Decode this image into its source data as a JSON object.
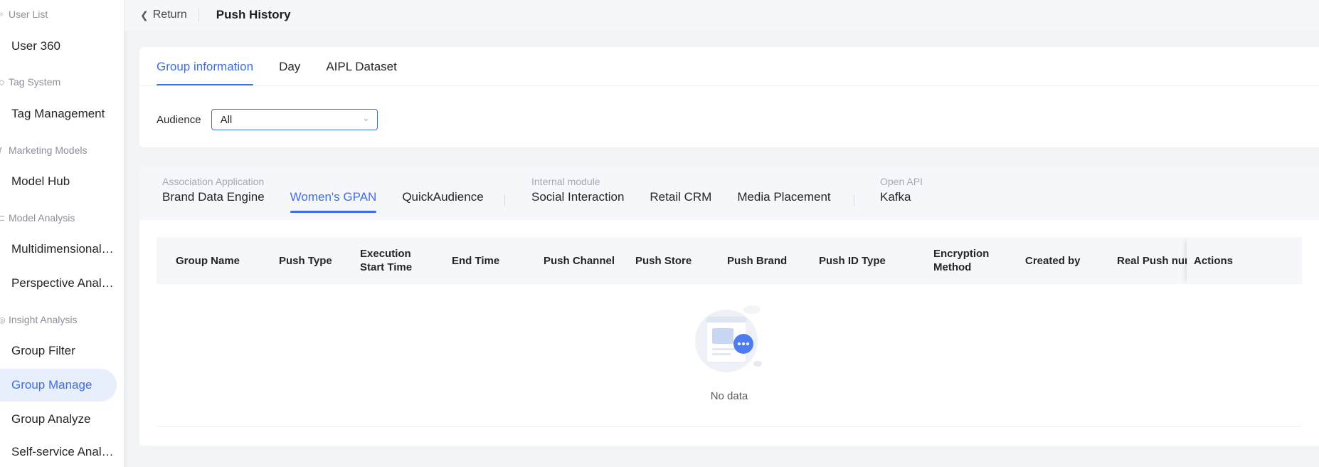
{
  "sidebar": {
    "groups": [
      {
        "label": "User List",
        "icon": "users-icon"
      },
      {
        "label": "Tag System",
        "icon": "tag-icon"
      },
      {
        "label": "Marketing Models",
        "icon": "model-icon"
      },
      {
        "label": "Model Analysis",
        "icon": "analysis-icon"
      },
      {
        "label": "Insight Analysis",
        "icon": "insight-icon"
      }
    ],
    "items": [
      {
        "label": "User 360"
      },
      {
        "label": "Tag Management"
      },
      {
        "label": "Model Hub"
      },
      {
        "label": "Multidimensional Analysis"
      },
      {
        "label": "Perspective Analysis"
      },
      {
        "label": "Group Filter"
      },
      {
        "label": "Group Manage",
        "active": true
      },
      {
        "label": "Group Analyze"
      },
      {
        "label": "Self-service Analysis"
      }
    ]
  },
  "header": {
    "return_label": "Return",
    "title": "Push History"
  },
  "main_tabs": [
    {
      "label": "Group information",
      "active": true
    },
    {
      "label": "Day"
    },
    {
      "label": "AIPL Dataset"
    }
  ],
  "filter": {
    "label": "Audience",
    "value": "All"
  },
  "channels": {
    "association": {
      "title": "Association Application",
      "tabs": [
        "Brand Data Engine",
        "Women's GPAN",
        "QuickAudience"
      ]
    },
    "internal": {
      "title": "Internal module",
      "tabs": [
        "Social Interaction",
        "Retail CRM",
        "Media Placement"
      ]
    },
    "open_api": {
      "title": "Open API",
      "tabs": [
        "Kafka"
      ]
    },
    "active_tab": "Women's GPAN"
  },
  "table": {
    "columns": [
      "Group Name",
      "Push Type",
      "Execution Start Time",
      "End Time",
      "Push Channel",
      "Push Store",
      "Push Brand",
      "Push ID Type",
      "Encryption Method",
      "Created by",
      "Real Push num",
      "Actions"
    ],
    "rows": [],
    "empty_text": "No data"
  },
  "colors": {
    "accent": "#3d6ee8",
    "active_bg": "#e7eefc"
  }
}
